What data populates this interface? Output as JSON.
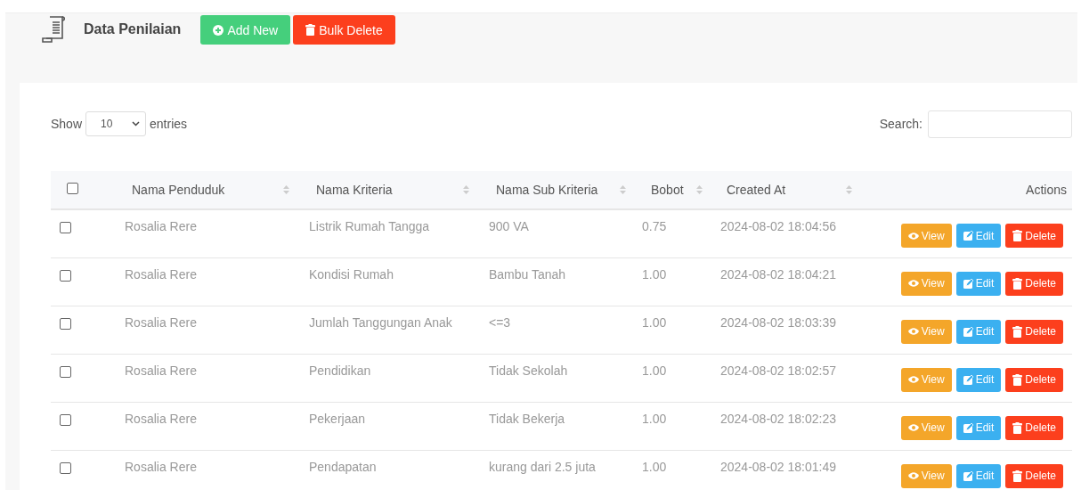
{
  "header": {
    "title": "Data Penilaian",
    "buttons": [
      {
        "label": "Add New",
        "kind": "add"
      },
      {
        "label": "Bulk Delete",
        "kind": "bulk-delete"
      }
    ]
  },
  "controls": {
    "show_label": "Show",
    "page_size": "10",
    "entries_label": "entries",
    "search_label": "Search:"
  },
  "table": {
    "select_all_checked": false,
    "columns": [
      {
        "label": "Nama Penduduk",
        "sortable": true
      },
      {
        "label": "Nama Kriteria",
        "sortable": true
      },
      {
        "label": "Nama Sub Kriteria",
        "sortable": true
      },
      {
        "label": "Bobot",
        "sortable": true
      },
      {
        "label": "Created At",
        "sortable": true
      },
      {
        "label": "Actions",
        "sortable": false
      }
    ],
    "rows": [
      {
        "checked": false,
        "cells": [
          "Rosalia Rere",
          "Listrik Rumah Tangga",
          "900 VA",
          "0.75",
          "2024-08-02 18:04:56"
        ],
        "actions": [
          {
            "label": "View",
            "kind": "view"
          },
          {
            "label": "Edit",
            "kind": "edit"
          },
          {
            "label": "Delete",
            "kind": "delete"
          }
        ]
      },
      {
        "checked": false,
        "cells": [
          "Rosalia Rere",
          "Kondisi Rumah",
          "Bambu Tanah",
          "1.00",
          "2024-08-02 18:04:21"
        ],
        "actions": [
          {
            "label": "View",
            "kind": "view"
          },
          {
            "label": "Edit",
            "kind": "edit"
          },
          {
            "label": "Delete",
            "kind": "delete"
          }
        ]
      },
      {
        "checked": false,
        "cells": [
          "Rosalia Rere",
          "Jumlah Tanggungan Anak",
          "<=3",
          "1.00",
          "2024-08-02 18:03:39"
        ],
        "actions": [
          {
            "label": "View",
            "kind": "view"
          },
          {
            "label": "Edit",
            "kind": "edit"
          },
          {
            "label": "Delete",
            "kind": "delete"
          }
        ]
      },
      {
        "checked": false,
        "cells": [
          "Rosalia Rere",
          "Pendidikan",
          "Tidak Sekolah",
          "1.00",
          "2024-08-02 18:02:57"
        ],
        "actions": [
          {
            "label": "View",
            "kind": "view"
          },
          {
            "label": "Edit",
            "kind": "edit"
          },
          {
            "label": "Delete",
            "kind": "delete"
          }
        ]
      },
      {
        "checked": false,
        "cells": [
          "Rosalia Rere",
          "Pekerjaan",
          "Tidak Bekerja",
          "1.00",
          "2024-08-02 18:02:23"
        ],
        "actions": [
          {
            "label": "View",
            "kind": "view"
          },
          {
            "label": "Edit",
            "kind": "edit"
          },
          {
            "label": "Delete",
            "kind": "delete"
          }
        ]
      },
      {
        "checked": false,
        "cells": [
          "Rosalia Rere",
          "Pendapatan",
          "kurang dari 2.5 juta",
          "1.00",
          "2024-08-02 18:01:49"
        ],
        "actions": [
          {
            "label": "View",
            "kind": "view"
          },
          {
            "label": "Edit",
            "kind": "edit"
          },
          {
            "label": "Delete",
            "kind": "delete"
          }
        ]
      }
    ]
  }
}
